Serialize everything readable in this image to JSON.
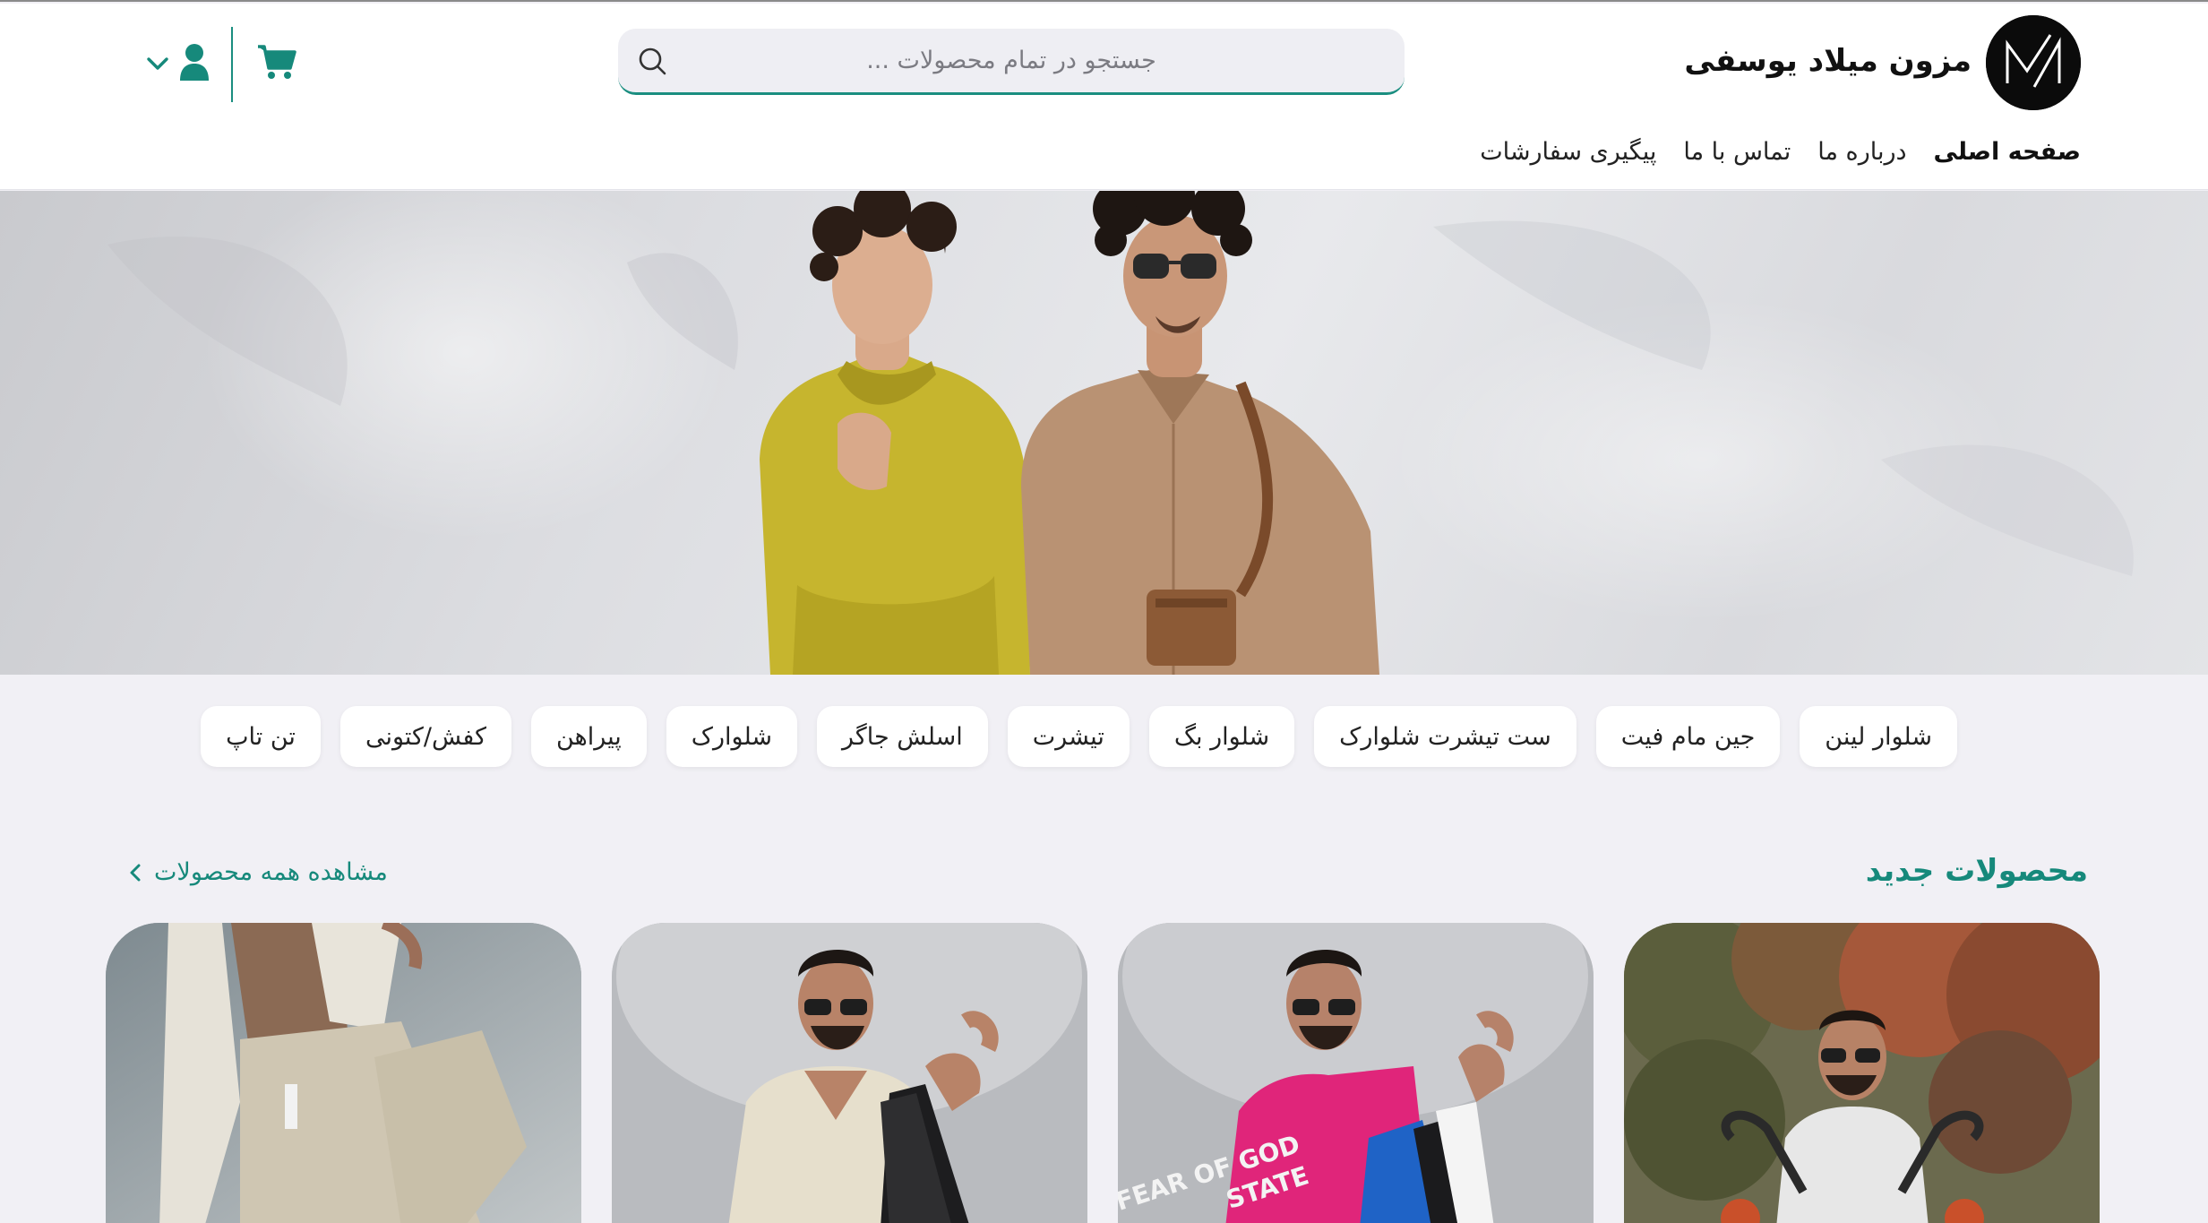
{
  "header": {
    "brand_name": "مزون میلاد یوسفی",
    "search_placeholder": "جستجو در تمام محصولات ...",
    "nav": [
      {
        "label": "صفحه اصلی",
        "active": true
      },
      {
        "label": "درباره ما",
        "active": false
      },
      {
        "label": "تماس با ما",
        "active": false
      },
      {
        "label": "پیگیری سفارشات",
        "active": false
      }
    ],
    "icons": [
      "search-icon",
      "cart-icon",
      "user-icon",
      "chevron-down-icon"
    ]
  },
  "categories": [
    "شلوار لینن",
    "جین مام فیت",
    "ست تیشرت شلوارک",
    "شلوار بگ",
    "تیشرت",
    "اسلش جاگر",
    "شلوارک",
    "پیراهن",
    "کفش/کتونی",
    "تن تاپ"
  ],
  "new_products": {
    "title": "محصولات جدید",
    "view_all_label": "مشاهده همه محصولات",
    "cards": [
      "product-card-1",
      "product-card-2",
      "product-card-3",
      "product-card-4"
    ]
  },
  "colors": {
    "accent": "#16897b",
    "background": "#f1f0f5",
    "header": "#ffffff"
  }
}
